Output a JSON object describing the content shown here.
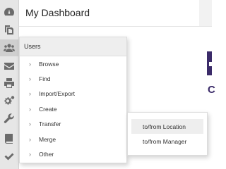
{
  "header": {
    "title": "My Dashboard"
  },
  "rail": {
    "icons": [
      "tachometer-icon",
      "copy-icon",
      "users-icon",
      "envelope-icon",
      "print-icon",
      "cogs-icon",
      "wrench-icon",
      "book-icon",
      "check-icon"
    ],
    "active": "users-icon"
  },
  "users_menu": {
    "title": "Users",
    "items": [
      {
        "label": "Browse"
      },
      {
        "label": "Find"
      },
      {
        "label": "Import/Export"
      },
      {
        "label": "Create"
      },
      {
        "label": "Transfer"
      },
      {
        "label": "Merge"
      },
      {
        "label": "Other"
      }
    ]
  },
  "transfer_submenu": {
    "items": [
      {
        "label": "to/from Location"
      },
      {
        "label": "to/from Manager"
      }
    ],
    "highlighted": "to/from Location"
  },
  "background": {
    "clipped_text": "C"
  },
  "colors": {
    "rail": "#e6e6e6",
    "brand": "#3b2b69",
    "menu_header": "#eeeeee"
  }
}
